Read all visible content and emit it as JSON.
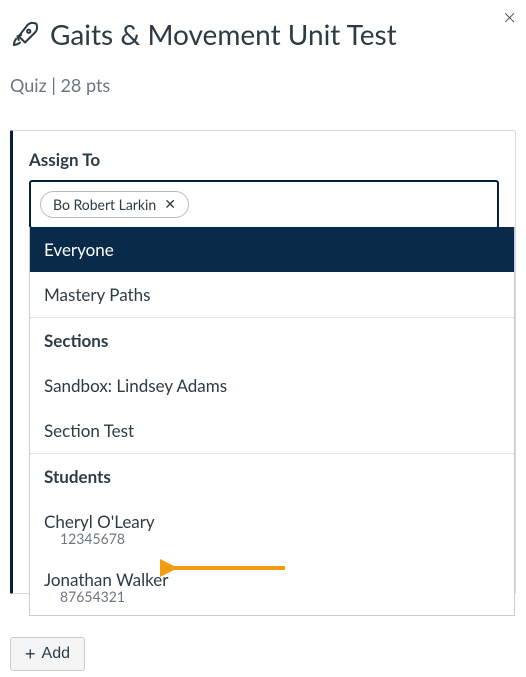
{
  "close_label": "×",
  "title": "Gaits & Movement Unit Test",
  "subtitle": "Quiz | 28 pts",
  "assign": {
    "label": "Assign To",
    "token": {
      "name": "Bo Robert Larkin",
      "remove_icon": "✕"
    },
    "dropdown": {
      "everyone": "Everyone",
      "mastery_paths": "Mastery Paths",
      "sections_header": "Sections",
      "sections": [
        "Sandbox: Lindsey Adams",
        "Section Test"
      ],
      "students_header": "Students",
      "students": [
        {
          "name": "Cheryl O'Leary",
          "sis": "12345678"
        },
        {
          "name": "Jonathan Walker",
          "sis": "87654321"
        }
      ]
    }
  },
  "add_button": "Add"
}
